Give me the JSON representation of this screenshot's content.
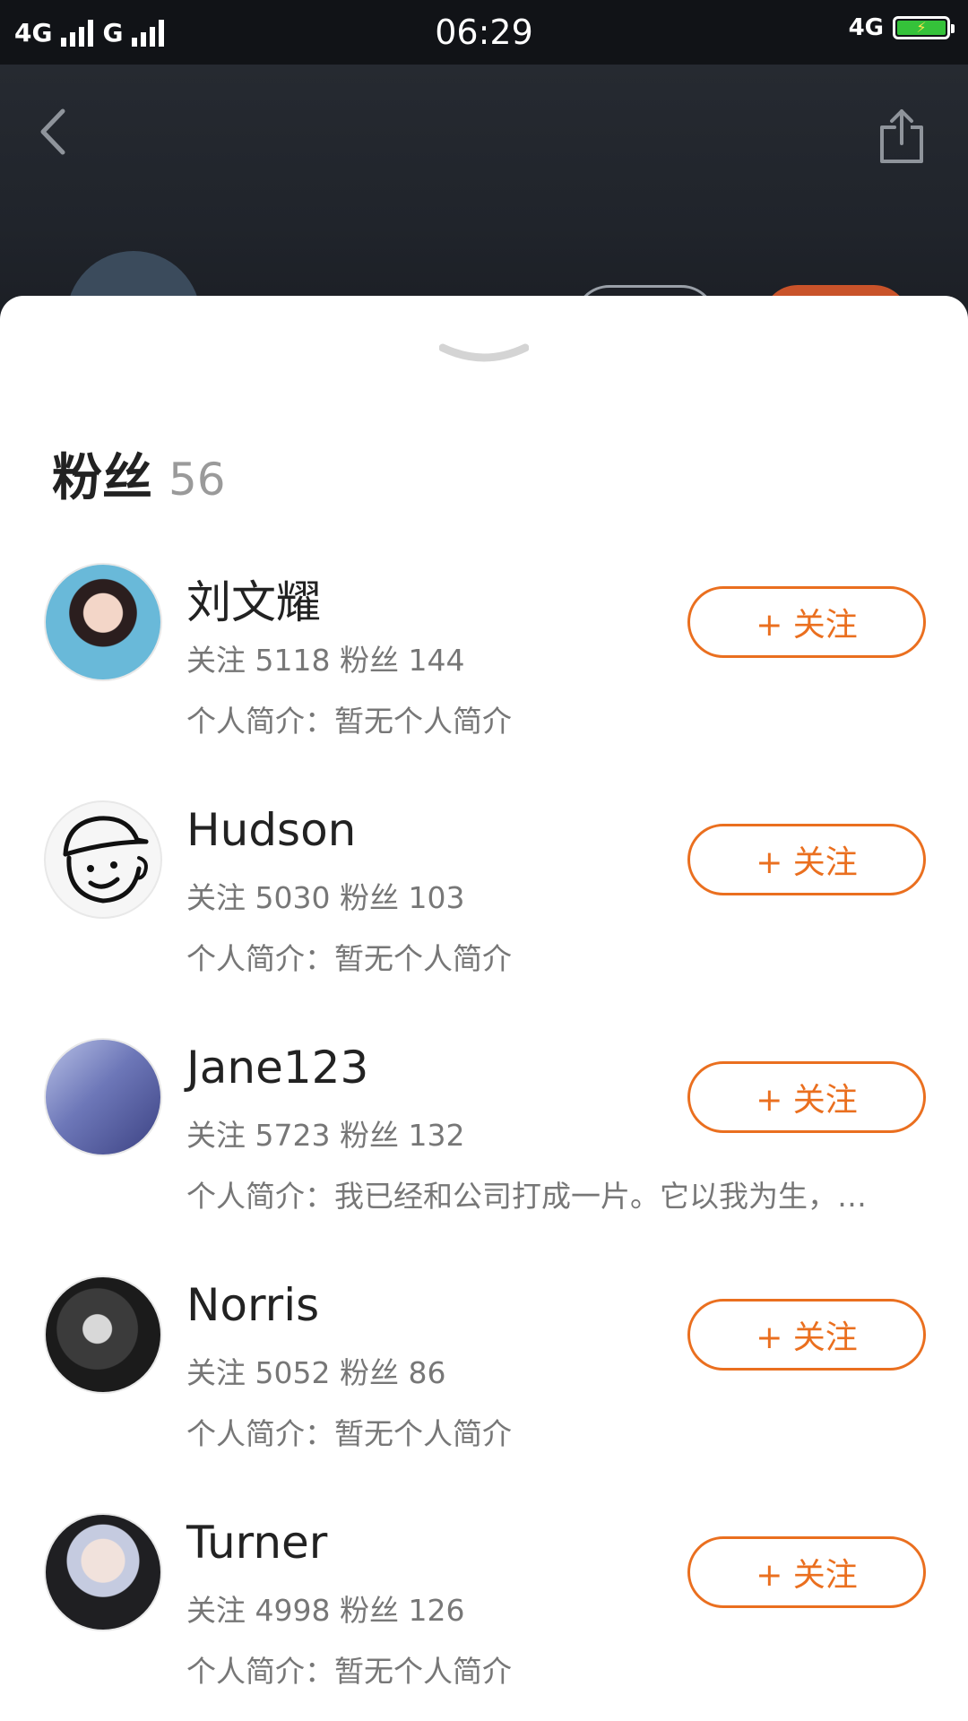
{
  "status_bar": {
    "network1": "4G",
    "network2": "G",
    "time": "06:29",
    "network3": "4G"
  },
  "header": {
    "back_icon": "chevron-left-icon",
    "share_icon": "share-icon"
  },
  "sheet": {
    "handle_icon": "chevron-down-icon",
    "title": "粉丝",
    "count": "56"
  },
  "colors": {
    "accent": "#ea6f1f",
    "text_primary": "#222222",
    "text_secondary": "#777777"
  },
  "followers": [
    {
      "name": "刘文耀",
      "stats": "关注 5118 粉丝 144",
      "bio": "个人简介：暂无个人简介",
      "button": "+ 关注"
    },
    {
      "name": "Hudson",
      "stats": "关注 5030 粉丝 103",
      "bio": "个人简介：暂无个人简介",
      "button": "+ 关注"
    },
    {
      "name": "Jane123",
      "stats": "关注 5723 粉丝 132",
      "bio": "个人简介：我已经和公司打成一片。它以我为生，…",
      "button": "+ 关注"
    },
    {
      "name": "Norris",
      "stats": "关注 5052 粉丝 86",
      "bio": "个人简介：暂无个人简介",
      "button": "+ 关注"
    },
    {
      "name": "Turner",
      "stats": "关注 4998 粉丝 126",
      "bio": "个人简介：暂无个人简介",
      "button": "+ 关注"
    }
  ]
}
